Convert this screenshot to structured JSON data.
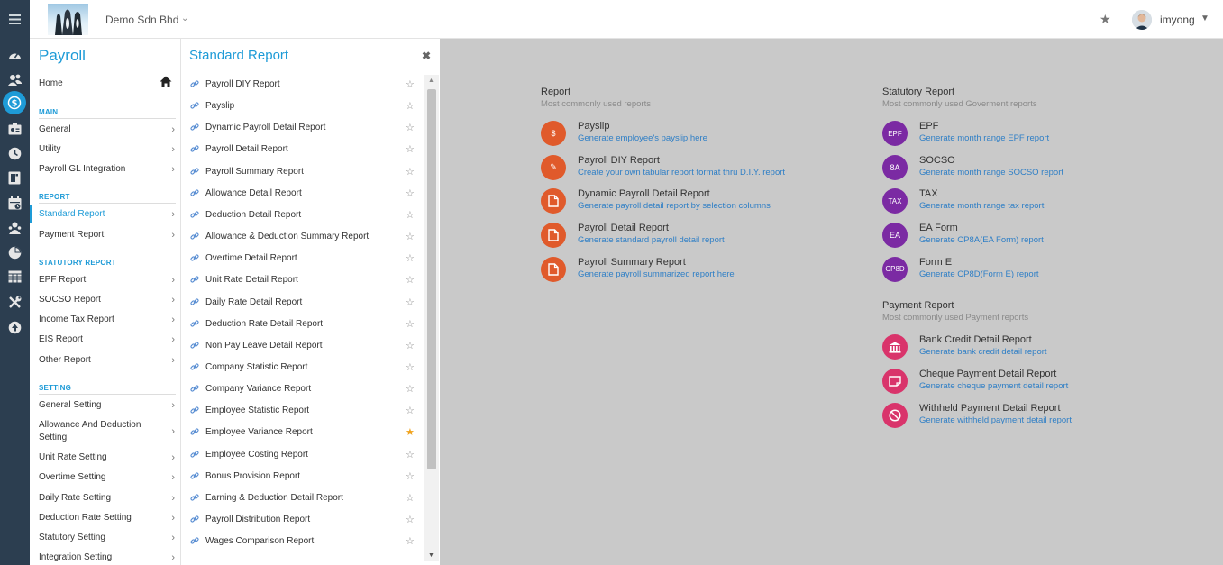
{
  "colors": {
    "accent": "#1e9bd7",
    "rail": "#2c3e50",
    "content_bg": "#c9c9c9",
    "report_icon": "#e05a2b",
    "statutory_icon": "#7b2aa3",
    "payment_icon": "#d9346b",
    "favourite_on": "#f0a21b"
  },
  "rail": {
    "icons": [
      "dashboard-icon",
      "users-icon",
      "payroll-icon",
      "id-card-icon",
      "clock-icon",
      "checklist-icon",
      "calendar-icon",
      "people-icon",
      "pie-chart-icon",
      "table-icon",
      "tools-icon",
      "arrow-up-circle-icon"
    ]
  },
  "topbar": {
    "company": "Demo Sdn Bhd",
    "username": "imyong"
  },
  "nav": {
    "title": "Payroll",
    "home": "Home",
    "sections": {
      "main": "MAIN",
      "report": "REPORT",
      "statutory": "STATUTORY REPORT",
      "setting": "SETTING"
    },
    "main_items": [
      "General",
      "Utility",
      "Payroll GL Integration"
    ],
    "report_items": [
      "Standard Report",
      "Payment Report"
    ],
    "statutory_items": [
      "EPF Report",
      "SOCSO Report",
      "Income Tax Report",
      "EIS Report",
      "Other Report"
    ],
    "setting_items": [
      "General Setting",
      "Allowance And Deduction Setting",
      "Unit Rate Setting",
      "Overtime Setting",
      "Daily Rate Setting",
      "Deduction Rate Setting",
      "Statutory Setting",
      "Integration Setting"
    ]
  },
  "panel": {
    "title": "Standard Report",
    "reports": [
      {
        "label": "Payroll DIY Report",
        "favourite": false
      },
      {
        "label": "Payslip",
        "favourite": false
      },
      {
        "label": "Dynamic Payroll Detail Report",
        "favourite": false
      },
      {
        "label": "Payroll Detail Report",
        "favourite": false
      },
      {
        "label": "Payroll Summary Report",
        "favourite": false
      },
      {
        "label": "Allowance Detail Report",
        "favourite": false
      },
      {
        "label": "Deduction Detail Report",
        "favourite": false
      },
      {
        "label": "Allowance & Deduction Summary Report",
        "favourite": false
      },
      {
        "label": "Overtime Detail Report",
        "favourite": false
      },
      {
        "label": "Unit Rate Detail Report",
        "favourite": false
      },
      {
        "label": "Daily Rate Detail Report",
        "favourite": false
      },
      {
        "label": "Deduction Rate Detail Report",
        "favourite": false
      },
      {
        "label": "Non Pay Leave Detail Report",
        "favourite": false
      },
      {
        "label": "Company Statistic Report",
        "favourite": false
      },
      {
        "label": "Company Variance Report",
        "favourite": false
      },
      {
        "label": "Employee Statistic Report",
        "favourite": false
      },
      {
        "label": "Employee Variance Report",
        "favourite": true
      },
      {
        "label": "Employee Costing Report",
        "favourite": false
      },
      {
        "label": "Bonus Provision Report",
        "favourite": false
      },
      {
        "label": "Earning & Deduction Detail Report",
        "favourite": false
      },
      {
        "label": "Payroll Distribution Report",
        "favourite": false
      },
      {
        "label": "Wages Comparison Report",
        "favourite": false
      }
    ]
  },
  "main": {
    "report": {
      "title": "Report",
      "subtitle": "Most commonly used reports",
      "cards": [
        {
          "icon": "dollar-icon",
          "glyph": "$",
          "name": "Payslip",
          "desc": "Generate employee's payslip here"
        },
        {
          "icon": "pencil-icon",
          "glyph": "✎",
          "name": "Payroll DIY Report",
          "desc": "Create your own tabular report format thru D.I.Y. report"
        },
        {
          "icon": "document-icon",
          "glyph": "",
          "name": "Dynamic Payroll Detail Report",
          "desc": "Generate payroll detail report by selection columns"
        },
        {
          "icon": "document-icon",
          "glyph": "",
          "name": "Payroll Detail Report",
          "desc": "Generate standard payroll detail report"
        },
        {
          "icon": "document-icon",
          "glyph": "",
          "name": "Payroll Summary Report",
          "desc": "Generate payroll summarized report here"
        }
      ]
    },
    "statutory": {
      "title": "Statutory Report",
      "subtitle": "Most commonly used Goverment reports",
      "cards": [
        {
          "icon": "epf-badge-icon",
          "glyph": "EPF",
          "name": "EPF",
          "desc": "Generate month range EPF report"
        },
        {
          "icon": "socso-badge-icon",
          "glyph": "8A",
          "name": "SOCSO",
          "desc": "Generate month range SOCSO report"
        },
        {
          "icon": "tax-badge-icon",
          "glyph": "TAX",
          "name": "TAX",
          "desc": "Generate month range tax report"
        },
        {
          "icon": "ea-badge-icon",
          "glyph": "EA",
          "name": "EA Form",
          "desc": "Generate CP8A(EA Form) report"
        },
        {
          "icon": "cp8d-badge-icon",
          "glyph": "CP8D",
          "name": "Form E",
          "desc": "Generate CP8D(Form E) report"
        }
      ]
    },
    "payment": {
      "title": "Payment Report",
      "subtitle": "Most commonly used Payment reports",
      "cards": [
        {
          "icon": "bank-icon",
          "glyph": "",
          "name": "Bank Credit Detail Report",
          "desc": "Generate bank credit detail report"
        },
        {
          "icon": "cheque-icon",
          "glyph": "",
          "name": "Cheque Payment Detail Report",
          "desc": "Generate cheque payment detail report"
        },
        {
          "icon": "withheld-icon",
          "glyph": "",
          "name": "Withheld Payment Detail Report",
          "desc": "Generate withheld payment detail report"
        }
      ]
    }
  }
}
